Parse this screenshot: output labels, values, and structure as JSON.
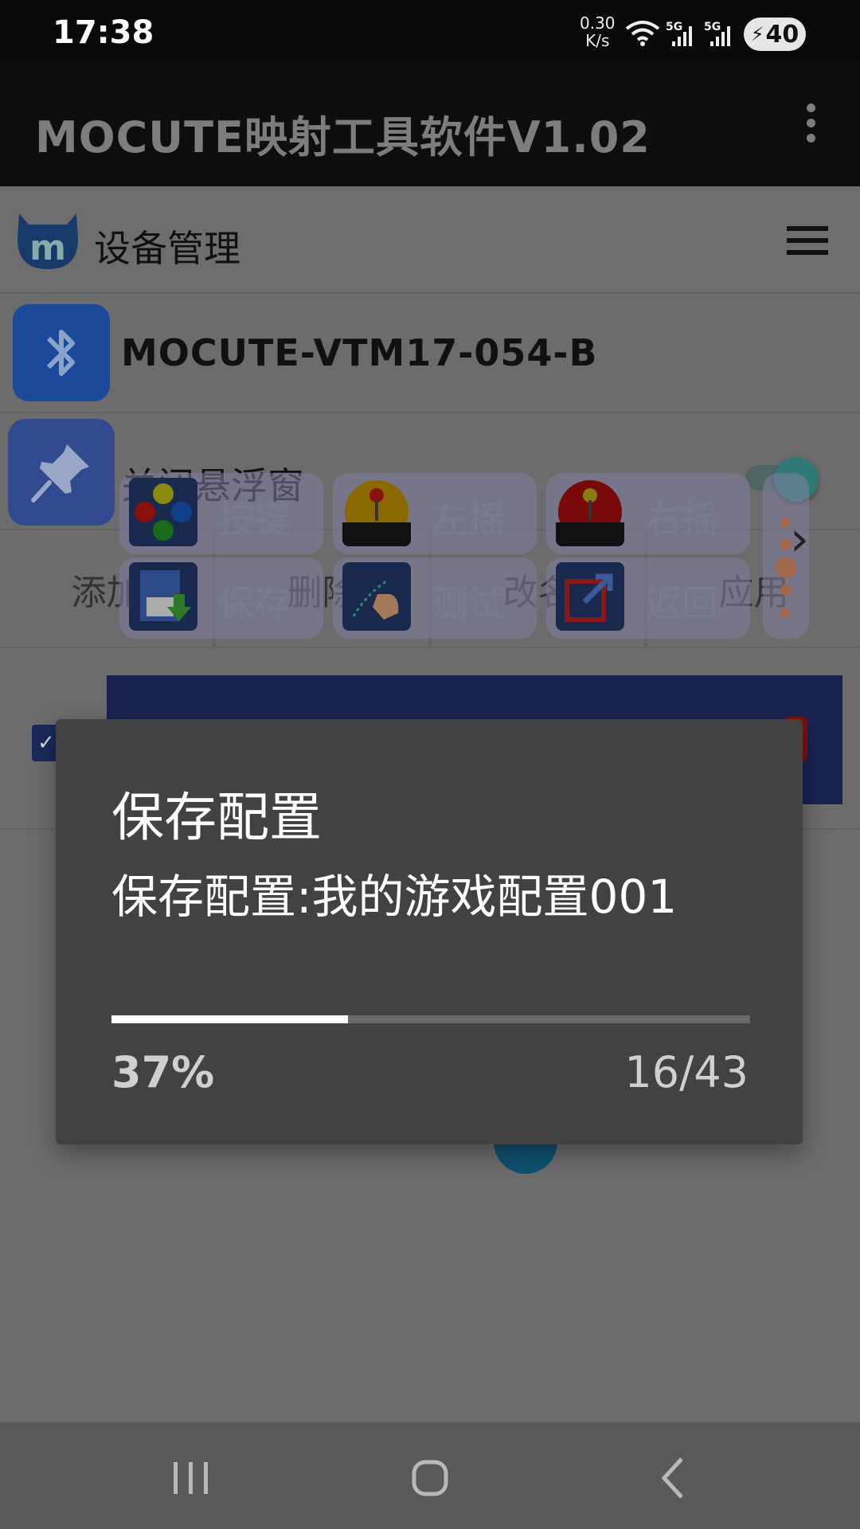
{
  "status_bar": {
    "time": "17:38",
    "net_speed_value": "0.30",
    "net_speed_unit": "K/s",
    "sim1": "5G",
    "sim2": "5G",
    "battery": "40"
  },
  "app_bar": {
    "title": "MOCUTE映射工具软件V1.02"
  },
  "header": {
    "label": "设备管理"
  },
  "device": {
    "name": "MOCUTE-VTM17-054-B"
  },
  "float_window": {
    "label": "关闭悬浮窗",
    "toggle_on": true
  },
  "actions": [
    "添加",
    "删除",
    "改名",
    "应用"
  ],
  "float_panel": {
    "buttons": [
      {
        "label": "按键",
        "icon": "xyab-buttons-icon"
      },
      {
        "label": "左摇",
        "icon": "left-joystick-icon"
      },
      {
        "label": "右摇",
        "icon": "right-joystick-icon"
      },
      {
        "label": "保存",
        "icon": "save-disk-icon"
      },
      {
        "label": "测试",
        "icon": "test-touch-icon"
      },
      {
        "label": "返回",
        "icon": "return-icon"
      }
    ]
  },
  "dialog": {
    "title": "保存配置",
    "message": "保存配置:我的游戏配置001",
    "progress_percent_label": "37%",
    "progress_fraction": 0.37,
    "progress_count": "16/43"
  },
  "colors": {
    "dialog_bg": "#424242",
    "progress_fill": "#ffffff",
    "progress_track": "#6a6a6a"
  }
}
